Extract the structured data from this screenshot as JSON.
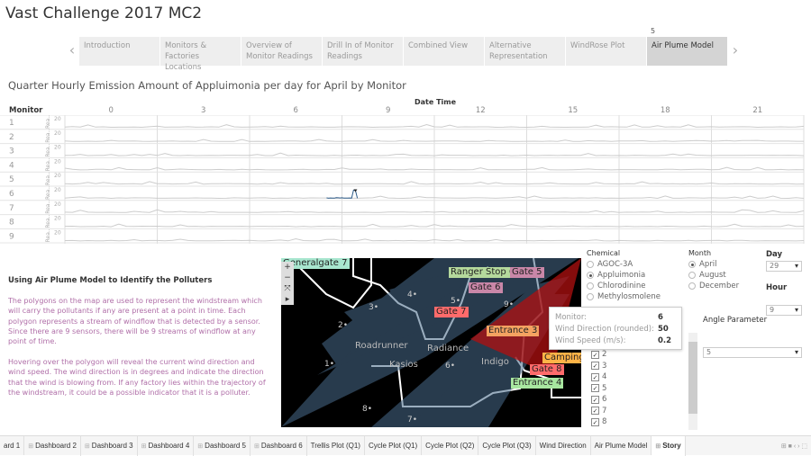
{
  "app_title": "Vast Challenge 2017 MC2",
  "story_points": [
    "Introduction",
    "Monitors & Factories Locations",
    "Overview of Monitor Readings",
    "Drill In of Monitor Readings",
    "Combined View",
    "Alternative Representation",
    "WindRose Plot",
    "Air Plume Model"
  ],
  "active_story_point": "Air Plume Model",
  "story_counter": "5",
  "chart_data": {
    "type": "line",
    "title": "Quarter Hourly Emission Amount of Appluimonia per day for April by Monitor",
    "xlabel": "Date Time",
    "row_label": "Monitor",
    "x_ticks": [
      "0",
      "3",
      "6",
      "9",
      "12",
      "15",
      "18",
      "21"
    ],
    "rows": [
      "1",
      "2",
      "3",
      "4",
      "5",
      "6",
      "7",
      "8",
      "9"
    ],
    "y_tick": "20",
    "y_axis_label": "Rea..",
    "highlighted": {
      "monitor": "6",
      "hour_range": [
        9,
        10
      ],
      "spike_hour": 10,
      "color": "#2e5c8a"
    }
  },
  "left_panel": {
    "heading": "Using Air Plume Model to Identify the Polluters",
    "para1": "The polygons on the map are used to represent the windstream which will carry the pollutants if any are present at a point in time. Each polygon represents a stream of windflow that is detected by a sensor. Since there are 9 sensors, there will be 9 streams of windflow at any point of time.",
    "para2": "Hovering over the polygon will reveal the current wind direction and wind speed. The wind direction is in degrees and indicate the direction that the wind is blowing from. If any factory lies within the trajectory of the windstream, it could be a possible indicator that it is a polluter."
  },
  "map": {
    "labels": [
      {
        "t": "Generalgate 7",
        "c": "#a8e6cf"
      },
      {
        "t": "Ranger Stop 6",
        "c": "#b5d99c"
      },
      {
        "t": "Gate 5",
        "c": "#c987a8"
      },
      {
        "t": "Gate 6",
        "c": "#c987a8"
      },
      {
        "t": "Gate 7",
        "c": "#ff6b6b"
      },
      {
        "t": "Entrance 3",
        "c": "#f4a261"
      },
      {
        "t": "Roadrunner",
        "c": ""
      },
      {
        "t": "Kasios",
        "c": ""
      },
      {
        "t": "Radiance",
        "c": ""
      },
      {
        "t": "Indigo",
        "c": ""
      },
      {
        "t": "Camping",
        "c": "#ffb347"
      },
      {
        "t": "Gate 8",
        "c": "#ff6b6b"
      },
      {
        "t": "Entrance 4",
        "c": "#a8e6a0"
      }
    ],
    "monitors": [
      "1",
      "2",
      "3",
      "4",
      "5",
      "6",
      "7",
      "8",
      "9"
    ],
    "tools": [
      "+",
      "−",
      "⤧",
      "▸"
    ]
  },
  "tooltip": {
    "rows": [
      {
        "k": "Monitor:",
        "v": "6"
      },
      {
        "k": "Wind Direction (rounded):",
        "v": "50"
      },
      {
        "k": "Wind Speed (m/s):",
        "v": "0.2"
      }
    ]
  },
  "filters": {
    "chemical_label": "Chemical",
    "chemicals": [
      "AGOC-3A",
      "Appluimonia",
      "Chlorodinine",
      "Methylosmolene"
    ],
    "chemical_selected": "Appluimonia",
    "month_label": "Month",
    "months": [
      "April",
      "August",
      "December"
    ],
    "month_selected": "April",
    "day_label": "Day",
    "day": "29",
    "hour_label": "Hour",
    "hour": "9",
    "angle_label": "Angle Parameter",
    "angle": "5",
    "monitor_checks": [
      "2",
      "3",
      "4",
      "5",
      "6",
      "7",
      "8"
    ]
  },
  "tabs": [
    "ard 1",
    "Dashboard 2",
    "Dashboard 3",
    "Dashboard 4",
    "Dashboard 5",
    "Dashboard 6",
    "Trellis Plot (Q1)",
    "Cycle Plot (Q1)",
    "Cycle Plot (Q2)",
    "Cycle Plot (Q3)",
    "Wind Direction",
    "Air Plume Model",
    "Story"
  ],
  "active_tab": "Story"
}
